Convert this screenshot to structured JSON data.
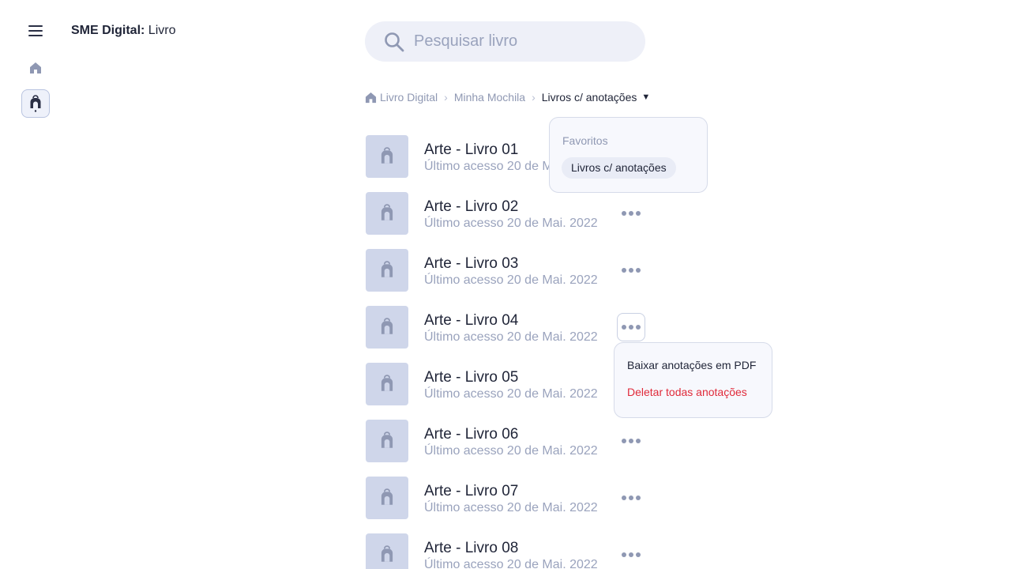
{
  "app": {
    "title_bold": "SME Digital:",
    "title_rest": " Livro"
  },
  "search": {
    "placeholder": "Pesquisar livro",
    "value": ""
  },
  "breadcrumb": {
    "items": [
      "Livro Digital",
      "Minha Mochila"
    ],
    "current": "Livros c/ anotações"
  },
  "filter_menu": {
    "label": "Favoritos",
    "selected": "Livros c/ anotações"
  },
  "book_menu": {
    "download": "Baixar anotações em PDF",
    "delete": "Deletar todas anotações"
  },
  "books": [
    {
      "title": "Arte - Livro 01",
      "subtitle": "Último acesso 20 de Mai. 2022"
    },
    {
      "title": "Arte - Livro 02",
      "subtitle": "Último acesso 20 de Mai. 2022"
    },
    {
      "title": "Arte - Livro 03",
      "subtitle": "Último acesso 20 de Mai. 2022"
    },
    {
      "title": "Arte - Livro 04",
      "subtitle": "Último acesso 20 de Mai. 2022"
    },
    {
      "title": "Arte - Livro 05",
      "subtitle": "Último acesso 20 de Mai. 2022"
    },
    {
      "title": "Arte - Livro 06",
      "subtitle": "Último acesso 20 de Mai. 2022"
    },
    {
      "title": "Arte - Livro 07",
      "subtitle": "Último acesso 20 de Mai. 2022"
    },
    {
      "title": "Arte - Livro 08",
      "subtitle": "Último acesso 20 de Mai. 2022"
    }
  ],
  "icons": {
    "menu": "hamburger-icon",
    "home": "home-icon",
    "backpack": "backpack-icon",
    "search": "search-icon",
    "more": "more-horizontal-icon",
    "chevron": "chevron-right-icon",
    "caret": "caret-down-icon"
  },
  "colors": {
    "accent_bg": "#eef1fa",
    "thumb": "#cfd6ea",
    "muted_text": "#9aa3bd",
    "danger": "#e02a3a"
  }
}
